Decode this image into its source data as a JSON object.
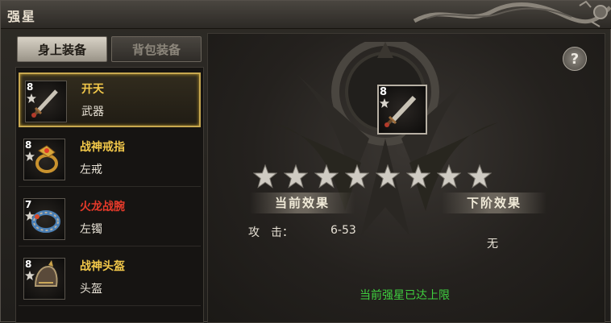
{
  "window": {
    "title": "强星"
  },
  "tabs": [
    {
      "label": "身上装备",
      "active": true
    },
    {
      "label": "背包装备",
      "active": false
    }
  ],
  "items": [
    {
      "level": "8",
      "name": "开天",
      "slot": "武器",
      "name_color": "#f2c84a",
      "icon": "sword-icon"
    },
    {
      "level": "8",
      "name": "战神戒指",
      "slot": "左戒",
      "name_color": "#f2c84a",
      "icon": "ring-icon"
    },
    {
      "level": "7",
      "name": "火龙战腕",
      "slot": "左镯",
      "name_color": "#e53a2a",
      "icon": "bracelet-icon"
    },
    {
      "level": "8",
      "name": "战神头盔",
      "slot": "头盔",
      "name_color": "#f2c84a",
      "icon": "helmet-icon"
    }
  ],
  "detail": {
    "help_label": "?",
    "level": "8",
    "star_count": 8,
    "current_effect_label": "当前效果",
    "next_effect_label": "下阶效果",
    "attr_label": "攻　击：",
    "attr_value": "6-53",
    "next_value": "无",
    "limit_text": "当前强星已达上限"
  },
  "colors": {
    "selected_border": "#c8a850",
    "limit_text": "#3fd03f"
  }
}
